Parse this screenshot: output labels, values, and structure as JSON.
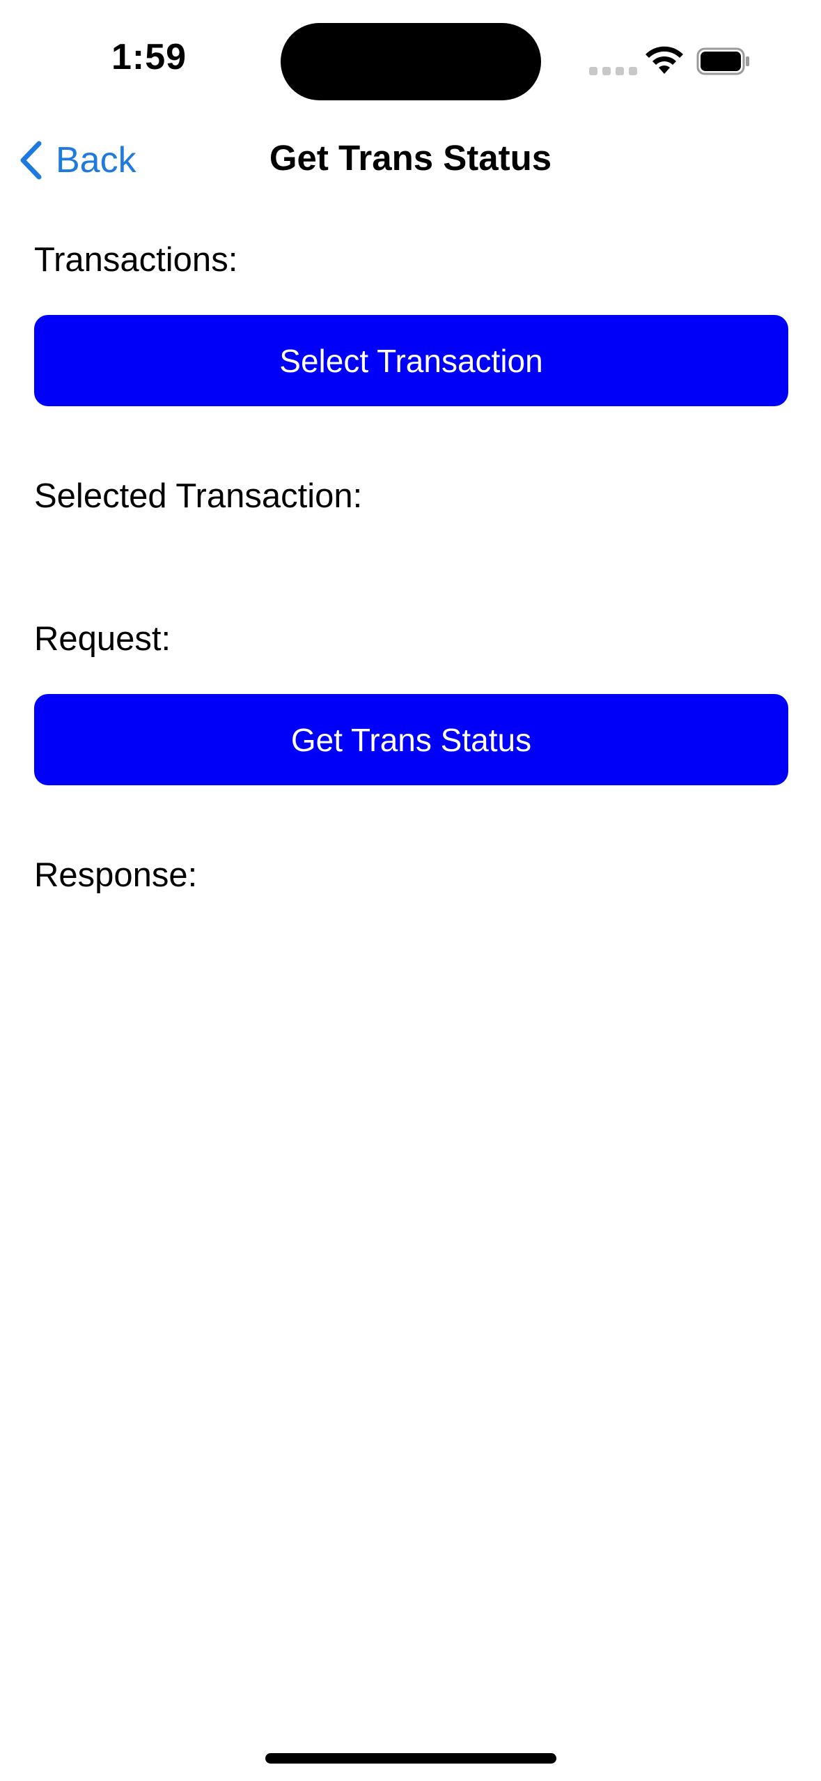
{
  "status_bar": {
    "time": "1:59",
    "icons": [
      "cellular-signal-icon",
      "wifi-icon",
      "battery-icon"
    ]
  },
  "nav": {
    "back_label": "Back",
    "title": "Get Trans Status",
    "back_icon": "chevron-left-icon"
  },
  "content": {
    "transactions_label": "Transactions:",
    "select_transaction_button": "Select Transaction",
    "selected_transaction_label": "Selected Transaction:",
    "request_label": "Request:",
    "get_trans_status_button": "Get Trans Status",
    "response_label": "Response:"
  },
  "colors": {
    "accent": "#1f7ae0",
    "button_background": "#0000fa",
    "button_text": "#ffffff"
  }
}
